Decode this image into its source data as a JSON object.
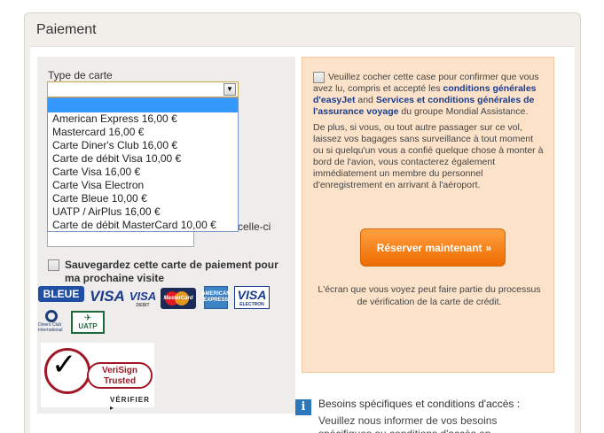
{
  "panel": {
    "title": "Paiement"
  },
  "card_type": {
    "label": "Type de carte",
    "selected": "",
    "options": [
      "American Express 16,00 €",
      "Mastercard 16,00 €",
      "Carte Diner's Club 16,00 €",
      "Carte de débit Visa 10,00 €",
      "Carte Visa 16,00 €",
      "Carte Visa Electron",
      "Carte Bleue 10,00 €",
      "UATP / AirPlus 16,00 €",
      "Carte de débit MasterCard 10,00 €"
    ],
    "hidden_tail": "celle-ci"
  },
  "save_card": {
    "label": "Sauvegardez cette carte de paiement pour ma prochaine visite"
  },
  "logos": {
    "bleue": "BLEUE",
    "visa": "VISA",
    "visa_debit": "VISA",
    "visa_debit_sub": "DEBIT",
    "mastercard": "MasterCard",
    "amex": "AMERICAN EXPRESS",
    "visa_electron": "VISA",
    "visa_electron_sub": "ELECTRON",
    "diners": "Diners Club International",
    "uatp": "UATP"
  },
  "verisign": {
    "line1": "VeriSign",
    "line2": "Trusted",
    "verify": "VÉRIFIER ▸"
  },
  "terms": {
    "t1": "Veuillez cocher cette case pour confirmer que vous avez lu, compris et accepté les ",
    "link1": "conditions générales d'easyJet",
    "t2": " and ",
    "link2": "Services et conditions générales de l'assurance voyage",
    "t3": " du groupe Mondial Assistance.",
    "p2": "De plus, si vous, ou tout autre passager sur ce vol, laissez vos bagages sans surveillance à tout moment ou si quelqu'un vous a confié quelque chose à monter à bord de l'avion, vous contacterez également immédiatement un membre du personnel d'enregistrement en arrivant à l'aéroport."
  },
  "reserve_button": {
    "label": "Réserver maintenant",
    "chevrons": "»"
  },
  "verification_note": "L'écran que vous voyez peut faire partie du processus de vérification de la carte de crédit.",
  "special_needs": {
    "icon": "i",
    "title": "Besoins spécifiques et conditions d'accès :",
    "text": "Veuillez nous informer de vos besoins spécifiques ou conditions d'accès en"
  }
}
